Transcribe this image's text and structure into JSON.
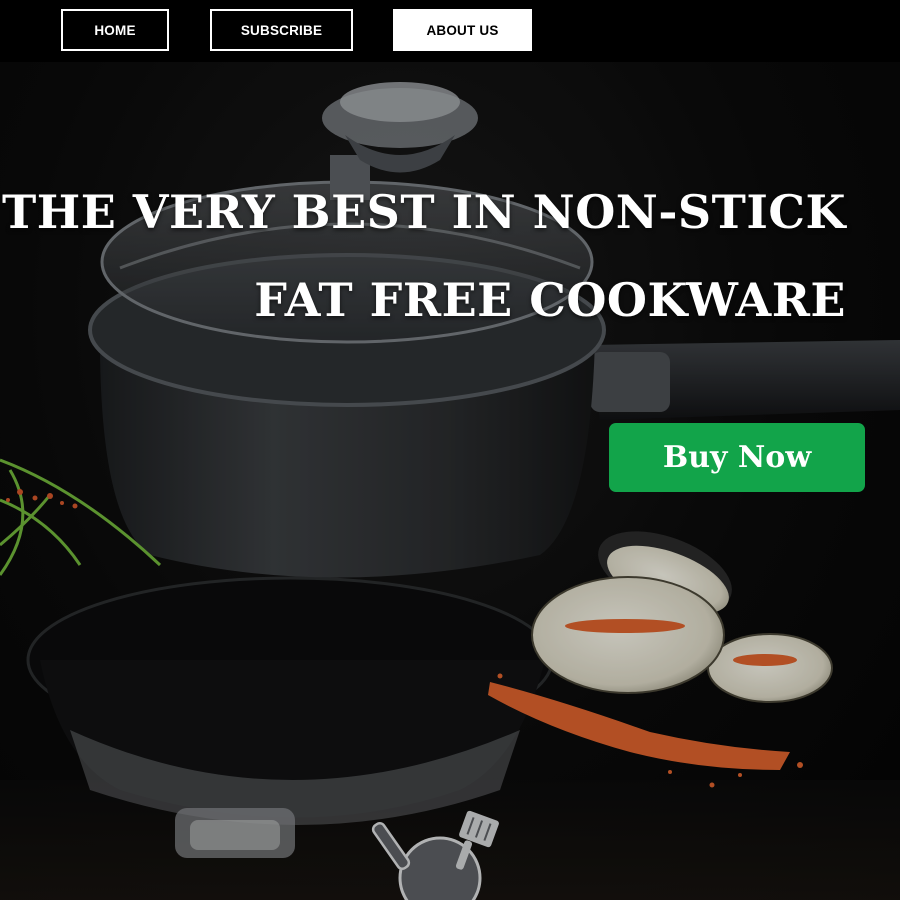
{
  "nav": {
    "items": [
      {
        "label": "HOME"
      },
      {
        "label": "SUBSCRIBE"
      },
      {
        "label": "ABOUT US"
      }
    ]
  },
  "hero": {
    "headline_line1": "THE VERY BEST IN NON-STICK",
    "headline_line2": "FAT FREE COOKWARE",
    "cta_label": "Buy Now"
  },
  "colors": {
    "background": "#050505",
    "cta": "#12a44a",
    "nav_active_bg": "#ffffff",
    "text": "#ffffff"
  },
  "icons": [
    "saucepan-with-lid-image",
    "eggplant-slices-image",
    "herb-sprig-image",
    "spice-crumbs-image",
    "pan-spatula-logo-icon"
  ]
}
